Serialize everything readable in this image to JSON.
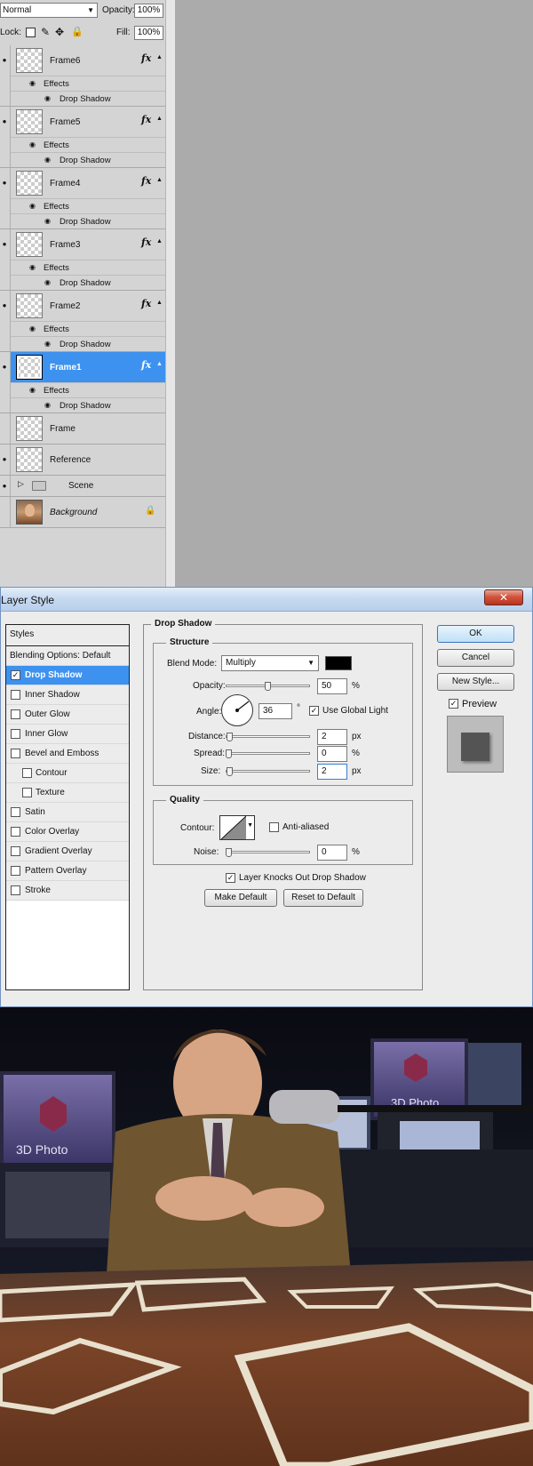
{
  "layers_panel": {
    "blend_mode": "Normal",
    "opacity_label": "Opacity:",
    "opacity_value": "100%",
    "lock_label": "Lock:",
    "fill_label": "Fill:",
    "fill_value": "100%",
    "layers": [
      {
        "name": "Frame6",
        "effects_label": "Effects",
        "effect": "Drop Shadow"
      },
      {
        "name": "Frame5",
        "effects_label": "Effects",
        "effect": "Drop Shadow"
      },
      {
        "name": "Frame4",
        "effects_label": "Effects",
        "effect": "Drop Shadow"
      },
      {
        "name": "Frame3",
        "effects_label": "Effects",
        "effect": "Drop Shadow"
      },
      {
        "name": "Frame2",
        "effects_label": "Effects",
        "effect": "Drop Shadow"
      },
      {
        "name": "Frame1",
        "effects_label": "Effects",
        "effect": "Drop Shadow",
        "selected": true
      },
      {
        "name": "Frame"
      },
      {
        "name": "Reference"
      },
      {
        "name": "Scene"
      },
      {
        "name": "Background"
      }
    ],
    "fx_label": "fx"
  },
  "dialog": {
    "title": "Layer Style",
    "close_glyph": "✕",
    "styles_header": "Styles",
    "blending_options": "Blending Options: Default",
    "styles": [
      {
        "label": "Drop Shadow",
        "checked": true,
        "selected": true
      },
      {
        "label": "Inner Shadow"
      },
      {
        "label": "Outer Glow"
      },
      {
        "label": "Inner Glow"
      },
      {
        "label": "Bevel and Emboss"
      },
      {
        "label": "Contour",
        "indent": true
      },
      {
        "label": "Texture",
        "indent": true
      },
      {
        "label": "Satin"
      },
      {
        "label": "Color Overlay"
      },
      {
        "label": "Gradient Overlay"
      },
      {
        "label": "Pattern Overlay"
      },
      {
        "label": "Stroke"
      }
    ],
    "section_title": "Drop Shadow",
    "structure_title": "Structure",
    "blend_mode_label": "Blend Mode:",
    "blend_mode_value": "Multiply",
    "shadow_color": "#000000",
    "opacity_label": "Opacity:",
    "opacity_value": "50",
    "opacity_unit": "%",
    "angle_label": "Angle:",
    "angle_value": "36",
    "angle_unit": "°",
    "use_global_light": "Use Global Light",
    "distance_label": "Distance:",
    "distance_value": "2",
    "distance_unit": "px",
    "spread_label": "Spread:",
    "spread_value": "0",
    "spread_unit": "%",
    "size_label": "Size:",
    "size_value": "2",
    "size_unit": "px",
    "quality_title": "Quality",
    "contour_label": "Contour:",
    "anti_aliased": "Anti-aliased",
    "noise_label": "Noise:",
    "noise_value": "0",
    "noise_unit": "%",
    "layer_knocks_out": "Layer Knocks Out Drop Shadow",
    "make_default": "Make Default",
    "reset_to_default": "Reset to Default",
    "ok": "OK",
    "cancel": "Cancel",
    "new_style": "New Style...",
    "preview": "Preview"
  },
  "scene": {
    "monitor_logo_text": "3D Photo",
    "colors": {
      "desk": "#6b3a24",
      "jacket": "#6f5530",
      "frame": "#e8e0cc"
    }
  }
}
